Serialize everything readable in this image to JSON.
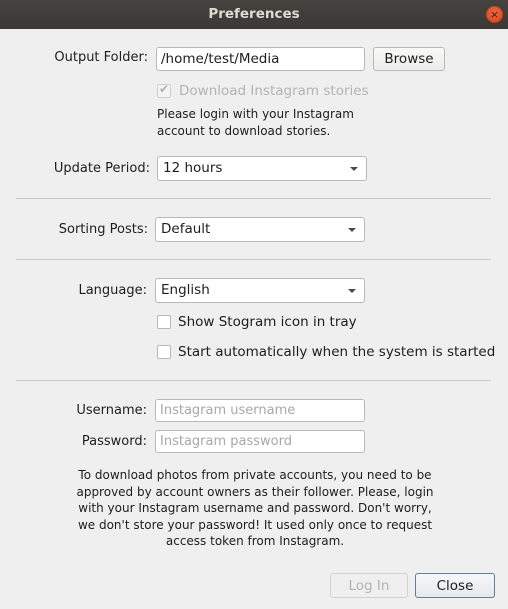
{
  "window": {
    "title": "Preferences",
    "close_icon": "×"
  },
  "output_folder": {
    "label": "Output Folder:",
    "value": "/home/test/Media",
    "browse_label": "Browse"
  },
  "stories": {
    "checkbox_label": "Download Instagram stories",
    "checked": true,
    "enabled": false,
    "note_line1": "Please login with your Instagram",
    "note_line2": "account to download stories."
  },
  "update_period": {
    "label": "Update Period:",
    "selected": "12 hours"
  },
  "sorting_posts": {
    "label": "Sorting Posts:",
    "selected": "Default"
  },
  "language": {
    "label": "Language:",
    "selected": "English"
  },
  "options": {
    "tray_label": "Show Stogram icon in tray",
    "tray_checked": false,
    "autostart_label": "Start automatically when the system is started",
    "autostart_checked": false
  },
  "login": {
    "username_label": "Username:",
    "username_placeholder": "Instagram username",
    "username_value": "",
    "password_label": "Password:",
    "password_placeholder": "Instagram password",
    "password_value": "",
    "info_lines": [
      "To download photos from private accounts, you need to be",
      "approved by account owners as their follower. Please, login",
      "with your Instagram username and password. Don't worry,",
      "we don't store your password! It used only once to request",
      "access token from Instagram."
    ]
  },
  "footer": {
    "login_label": "Log In",
    "close_label": "Close"
  }
}
